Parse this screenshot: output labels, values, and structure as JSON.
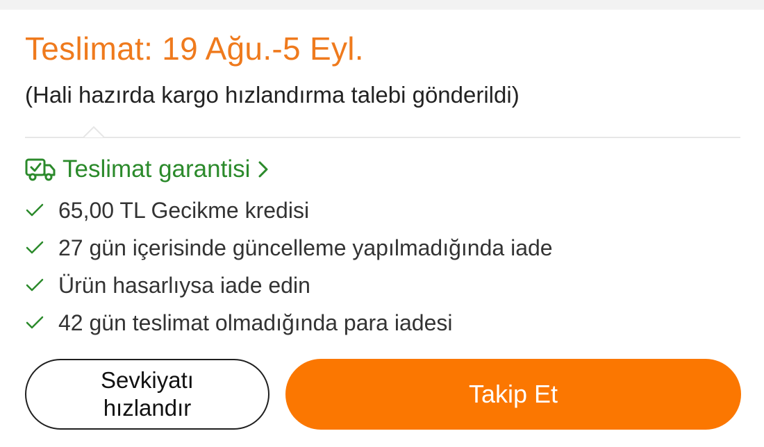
{
  "delivery": {
    "title": "Teslimat: 19 Ağu.-5 Eyl.",
    "subtitle": "(Hali hazırda kargo hızlandırma talebi gönderildi)"
  },
  "guarantee": {
    "label": "Teslimat garantisi",
    "icon": "truck-check-icon",
    "chevron": "chevron-right-icon",
    "benefits": [
      "65,00 TL Gecikme kredisi",
      "27 gün içerisinde güncelleme yapılmadığında iade",
      "Ürün hasarlıysa iade edin",
      "42 gün teslimat olmadığında para iadesi"
    ]
  },
  "actions": {
    "secondary_label": "Sevkiyatı hızlandır",
    "primary_label": "Takip Et"
  },
  "colors": {
    "accent_orange": "#fb7701",
    "title_orange": "#ef7a1d",
    "guarantee_green": "#2b8a2b"
  }
}
